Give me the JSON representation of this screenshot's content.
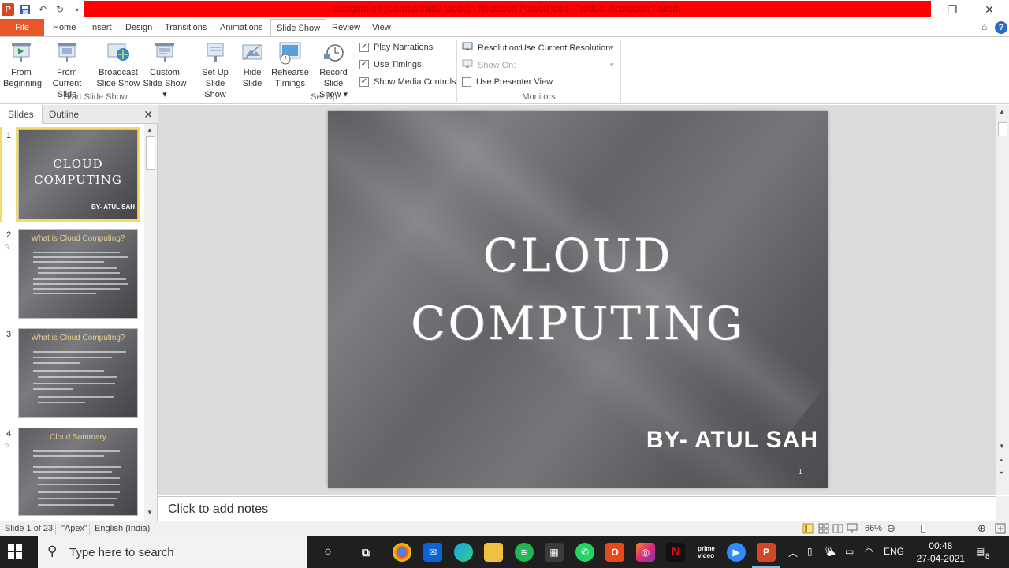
{
  "window": {
    "title": "assignment [Compatibility Mode] - Microsoft PowerPoint (Product Activation Failed)"
  },
  "tabs": [
    "File",
    "Home",
    "Insert",
    "Design",
    "Transitions",
    "Animations",
    "Slide Show",
    "Review",
    "View"
  ],
  "active_tab": "Slide Show",
  "ribbon": {
    "start_group": {
      "label": "Start Slide Show",
      "from_beginning": [
        "From",
        "Beginning"
      ],
      "from_current": [
        "From",
        "Current Slide"
      ],
      "broadcast": [
        "Broadcast",
        "Slide Show"
      ],
      "custom": [
        "Custom",
        "Slide Show ▾"
      ]
    },
    "setup_group": {
      "label": "Set Up",
      "setup_show": [
        "Set Up",
        "Slide Show"
      ],
      "hide_slide": [
        "Hide",
        "Slide"
      ],
      "rehearse": [
        "Rehearse",
        "Timings"
      ],
      "record": [
        "Record Slide",
        "Show ▾"
      ],
      "play_narrations": "Play Narrations",
      "use_timings": "Use Timings",
      "show_media_controls": "Show Media Controls"
    },
    "monitors_group": {
      "label": "Monitors",
      "resolution_label": "Resolution:",
      "resolution_value": "Use Current Resolution",
      "show_on_label": "Show On:",
      "presenter_view": "Use Presenter View"
    }
  },
  "left_pane": {
    "tabs": [
      "Slides",
      "Outline"
    ],
    "thumbnails": [
      {
        "num": "1",
        "title_line1": "CLOUD",
        "title_line2": "COMPUTING",
        "by": "BY- ATUL SAH"
      },
      {
        "num": "2",
        "heading": "What is Cloud Computing?"
      },
      {
        "num": "3",
        "heading": "What is Cloud Computing?"
      },
      {
        "num": "4",
        "heading": "Cloud Summary"
      }
    ]
  },
  "slide": {
    "title_line1": "CLOUD",
    "title_line2": "COMPUTING",
    "byline": "BY- ATUL SAH",
    "number": "1"
  },
  "notes_placeholder": "Click to add notes",
  "status": {
    "slide": "Slide 1 of 23",
    "theme": "\"Apex\"",
    "language": "English (India)",
    "zoom": "66%"
  },
  "taskbar": {
    "search_placeholder": "Type here to search",
    "time": "00:48",
    "date": "27-04-2021",
    "lang": "ENG",
    "notif_count": "8"
  },
  "colors": {
    "title_bar_red": "#ff0000",
    "file_tab": "#e8572a",
    "selection_yellow": "#f6d967"
  }
}
